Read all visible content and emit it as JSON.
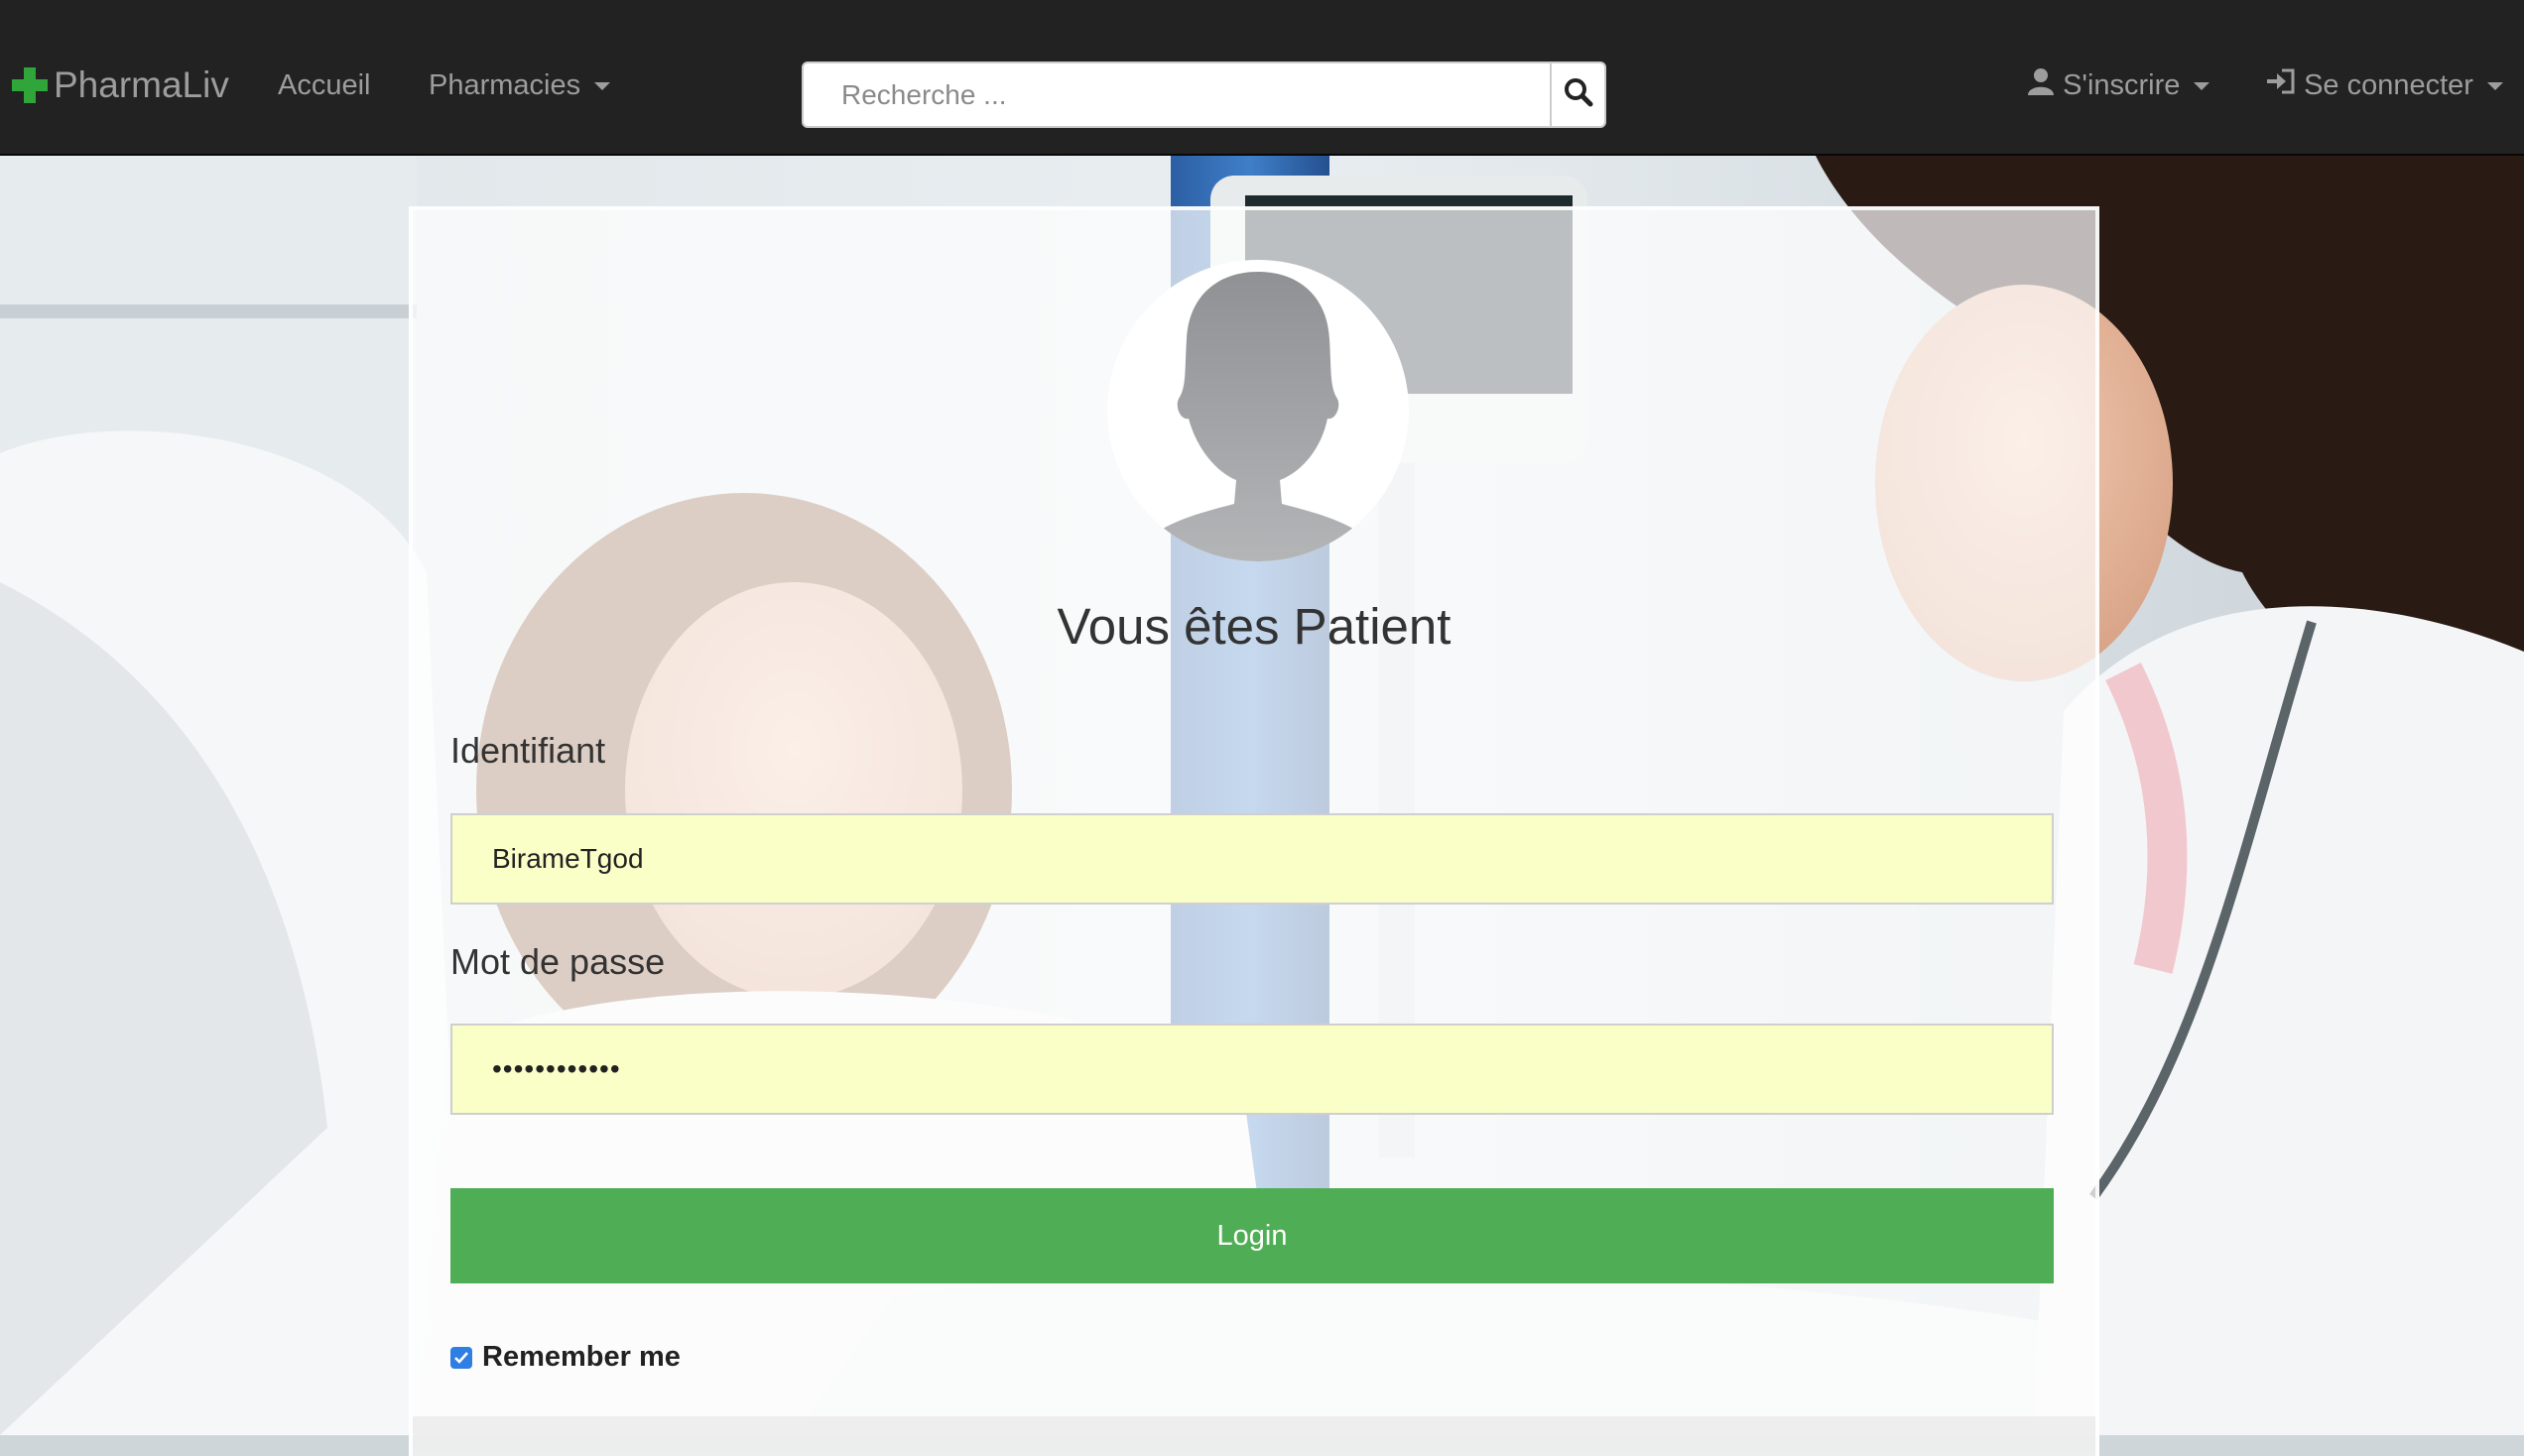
{
  "navbar": {
    "brand": "PharmaLiv",
    "links": {
      "home": "Accueil",
      "pharmacies": "Pharmacies"
    },
    "search": {
      "placeholder": "Recherche ..."
    },
    "register": "S'inscrire",
    "login": "Se connecter"
  },
  "login_form": {
    "title": "Vous êtes Patient",
    "username_label": "Identifiant",
    "username_value": "BirameTgod",
    "password_label": "Mot de passe",
    "password_value": "••••••••••••",
    "submit_label": "Login",
    "remember_label": "Remember me",
    "remember_checked": true
  },
  "colors": {
    "navbar_bg": "#222222",
    "brand_cross": "#2fa53a",
    "login_button": "#4fae55",
    "input_bg": "#fafec7",
    "checkbox": "#2f7ee3"
  },
  "icons": [
    "plus-cross-icon",
    "caret-down-icon",
    "search-icon",
    "user-icon",
    "sign-in-icon",
    "checkmark-icon",
    "user-silhouette-icon"
  ]
}
